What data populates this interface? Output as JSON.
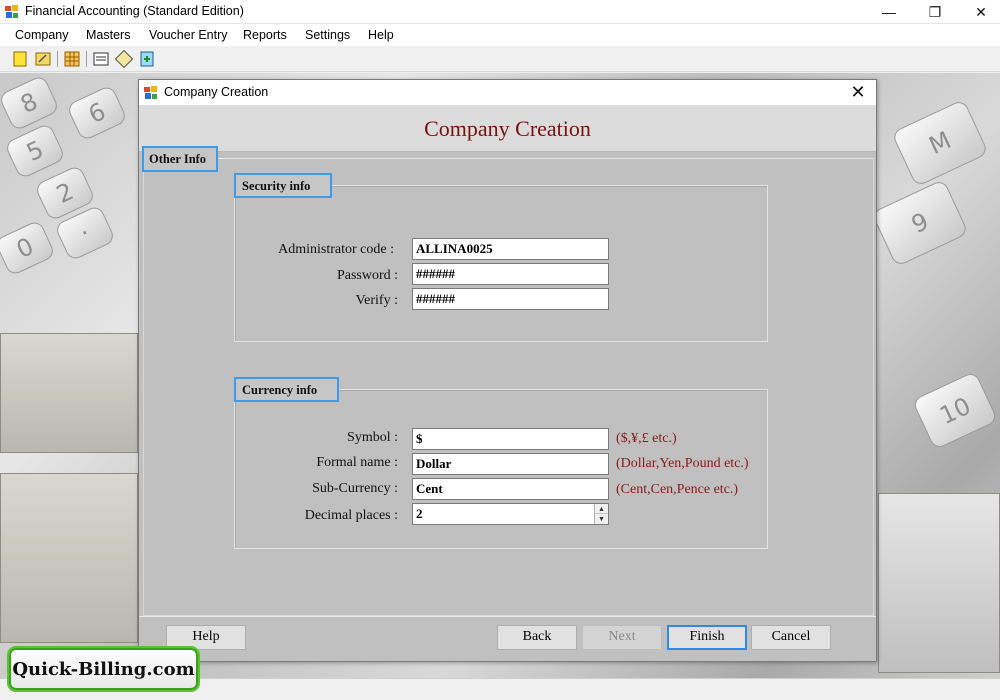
{
  "window": {
    "title": "Financial Accounting (Standard Edition)",
    "minimize": "—",
    "maximize": "❐",
    "close": "✕"
  },
  "menu": [
    "Company",
    "Masters",
    "Voucher Entry",
    "Reports",
    "Settings",
    "Help"
  ],
  "toolbar": [
    "new-company-icon",
    "open-company-icon",
    "table-icon",
    "voucher-icon",
    "edit-icon",
    "export-icon"
  ],
  "dialog": {
    "title": "Company Creation",
    "heading": "Company Creation",
    "close": "✕",
    "tab": "Other Info",
    "security": {
      "label": "Security info",
      "admin_label": "Administrator code :",
      "admin_value": "ALLINA0025",
      "password_label": "Password :",
      "password_value": "######",
      "verify_label": "Verify :",
      "verify_value": "######"
    },
    "currency": {
      "label": "Currency info",
      "symbol_label": "Symbol :",
      "symbol_value": "$",
      "symbol_hint": "($,¥,£ etc.)",
      "formal_label": "Formal name :",
      "formal_value": "Dollar",
      "formal_hint": "(Dollar,Yen,Pound etc.)",
      "sub_label": "Sub-Currency :",
      "sub_value": "Cent",
      "sub_hint": "(Cent,Cen,Pence etc.)",
      "decimal_label": "Decimal places :",
      "decimal_value": "2"
    },
    "buttons": {
      "help": "Help",
      "back": "Back",
      "next": "Next",
      "finish": "Finish",
      "cancel": "Cancel"
    }
  },
  "brand": "Quick-Billing.com",
  "colors": {
    "heading": "#7a1010",
    "hint": "#8b1a1a",
    "focus_border": "#3d9be9",
    "brand_border": "#5bc236"
  }
}
